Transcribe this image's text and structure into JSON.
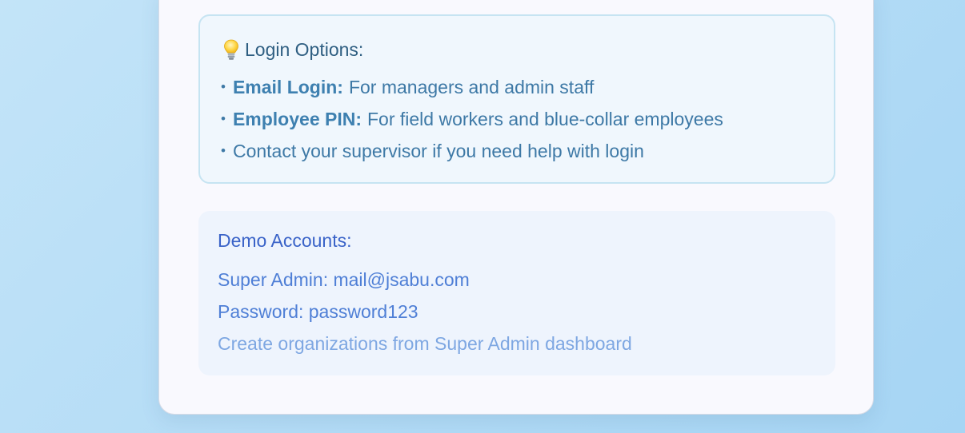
{
  "login_options": {
    "title": "Login Options:",
    "icon": "lightbulb-icon",
    "items": [
      {
        "bold": "Email Login:",
        "text": "For managers and admin staff"
      },
      {
        "bold": "Employee PIN:",
        "text": "For field workers and blue-collar employees"
      },
      {
        "bold": "",
        "text": "Contact your supervisor if you need help with login"
      }
    ]
  },
  "demo_accounts": {
    "title": "Demo Accounts:",
    "super_admin": "Super Admin: mail@jsabu.com",
    "password": "Password: password123",
    "note": "Create organizations from Super Admin dashboard"
  },
  "colors": {
    "background": "#b4dcf6",
    "card": "#f9f9fe",
    "info_box": "#f0f7fd",
    "info_border": "#c6e4f2",
    "demo_box": "#eef4fd",
    "accent_text": "#3e79a6",
    "demo_title": "#3a63c8"
  }
}
